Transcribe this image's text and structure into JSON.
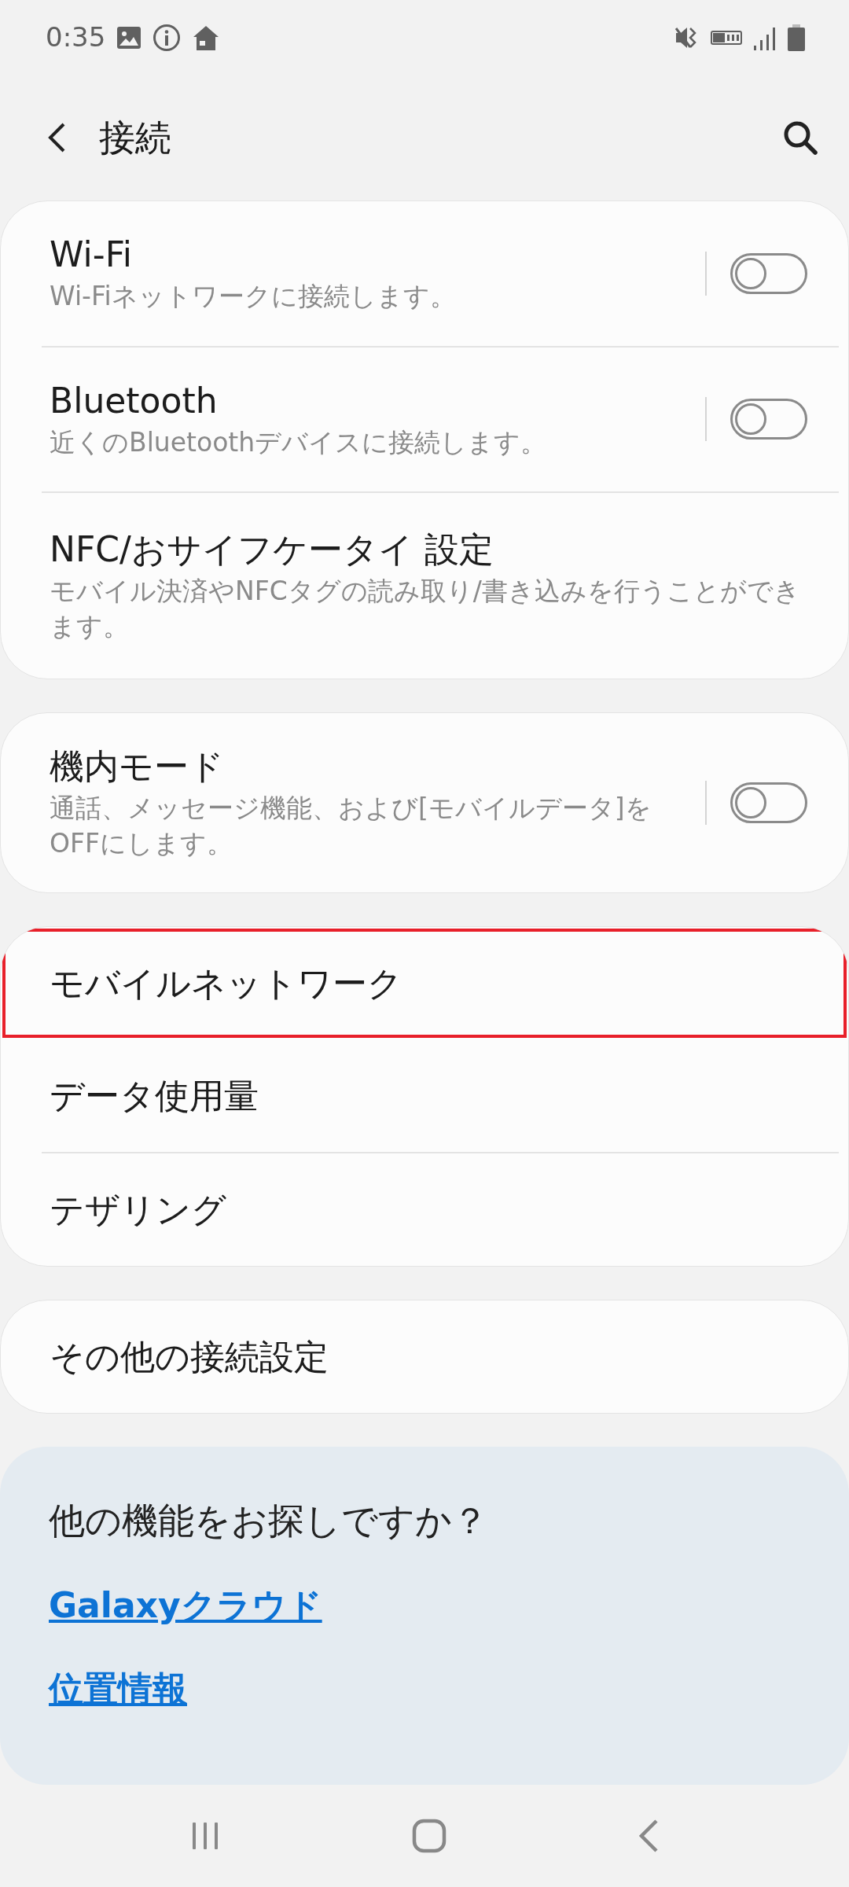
{
  "status_bar": {
    "time": "0:35"
  },
  "header": {
    "title": "接続"
  },
  "groups": [
    {
      "items": [
        {
          "kind": "toggle",
          "title": "Wi-Fi",
          "subtitle": "Wi-Fiネットワークに接続します。",
          "on": false
        },
        {
          "kind": "toggle",
          "title": "Bluetooth",
          "subtitle": "近くのBluetoothデバイスに接続します。",
          "on": false
        },
        {
          "kind": "link",
          "title": "NFC/おサイフケータイ 設定",
          "subtitle": "モバイル決済やNFCタグの読み取り/書き込みを行うことができます。"
        }
      ]
    },
    {
      "items": [
        {
          "kind": "toggle",
          "title": "機内モード",
          "subtitle": "通話、メッセージ機能、および[モバイルデータ]をOFFにします。",
          "on": false
        }
      ]
    },
    {
      "items": [
        {
          "kind": "link",
          "title": "モバイルネットワーク",
          "highlighted": true
        },
        {
          "kind": "link",
          "title": "データ使用量",
          "highlighted": false
        },
        {
          "kind": "link",
          "title": "テザリング",
          "highlighted": false
        }
      ]
    },
    {
      "items": [
        {
          "kind": "link",
          "title": "その他の接続設定"
        }
      ]
    }
  ],
  "suggestions": {
    "title": "他の機能をお探しですか？",
    "links": [
      "Galaxyクラウド",
      "位置情報"
    ]
  }
}
